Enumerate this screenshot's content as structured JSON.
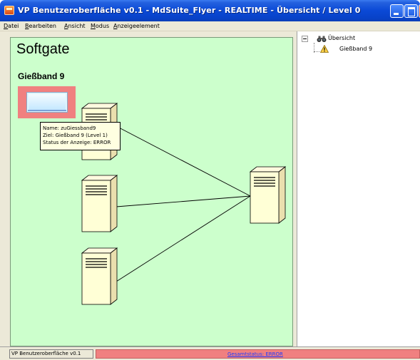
{
  "window": {
    "title": "VP Benutzeroberfläche v0.1 - MdSuite_Flyer - REALTIME - Übersicht / Level 0",
    "app_icon": "app-icon"
  },
  "menu": {
    "items": [
      {
        "accel": "D",
        "rest": "atei"
      },
      {
        "accel": "B",
        "rest": "earbeiten"
      },
      {
        "accel": "A",
        "rest": "nsicht"
      },
      {
        "accel": "M",
        "rest": "odus"
      },
      {
        "accel": "A",
        "rest": "nzeigeelement"
      }
    ]
  },
  "canvas": {
    "title": "Softgate",
    "group_label": "Gießband 9",
    "background_color": "#ccffcc",
    "widget_color": "#f08080",
    "tooltip": {
      "line1": "Name: zuGiessband9",
      "line2": "Ziel: Gießband 9 (Level 1)",
      "line3": "Status der Anzeige: ERROR"
    },
    "servers": [
      "server-icon",
      "server-icon",
      "server-icon",
      "server-icon"
    ]
  },
  "tree": {
    "root_label": "Übersicht",
    "root_icon": "binoculars-icon",
    "child_label": "Gießband 9",
    "child_icon": "warning-icon"
  },
  "statusbar": {
    "app_label": "VP Benutzeroberfläche v0.1",
    "overall_status": "Gesamtstatus: ERROR",
    "error_color": "#f08080"
  }
}
